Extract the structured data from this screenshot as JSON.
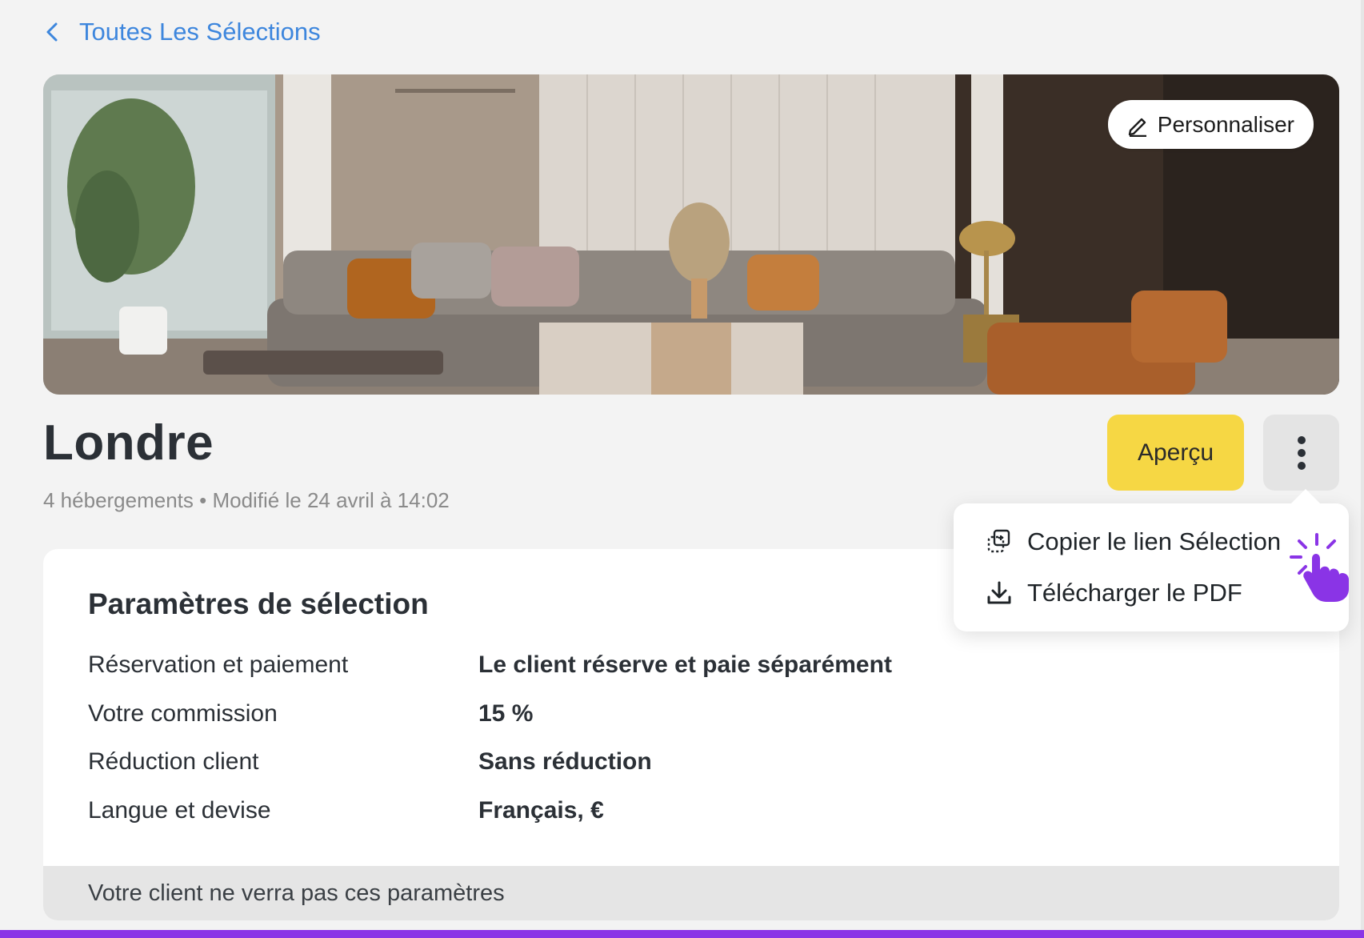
{
  "nav": {
    "back_label": "Toutes Les Sélections"
  },
  "hero": {
    "personalize_label": "Personnaliser",
    "image_alt": ""
  },
  "selection": {
    "title": "Londre",
    "meta": "4 hébergements • Modifié le 24 avril à 14:02"
  },
  "actions": {
    "preview_label": "Aperçu",
    "more_icon": "more-vertical-icon"
  },
  "menu": {
    "items": [
      {
        "label": "Copier le lien Sélection",
        "icon": "copy-link-icon"
      },
      {
        "label": "Télécharger le PDF",
        "icon": "download-icon"
      }
    ]
  },
  "settings": {
    "heading": "Paramètres de sélection",
    "rows": [
      {
        "label": "Réservation et paiement",
        "value": "Le client réserve et paie séparément"
      },
      {
        "label": "Votre commission",
        "value": "15 %"
      },
      {
        "label": "Réduction client",
        "value": "Sans réduction"
      },
      {
        "label": "Langue et devise",
        "value": "Français, €"
      }
    ],
    "note": "Votre client ne verra pas ces paramètres"
  },
  "colors": {
    "accent_yellow": "#f6d744",
    "link_blue": "#3d86dd",
    "cursor_purple": "#8a34e6"
  }
}
